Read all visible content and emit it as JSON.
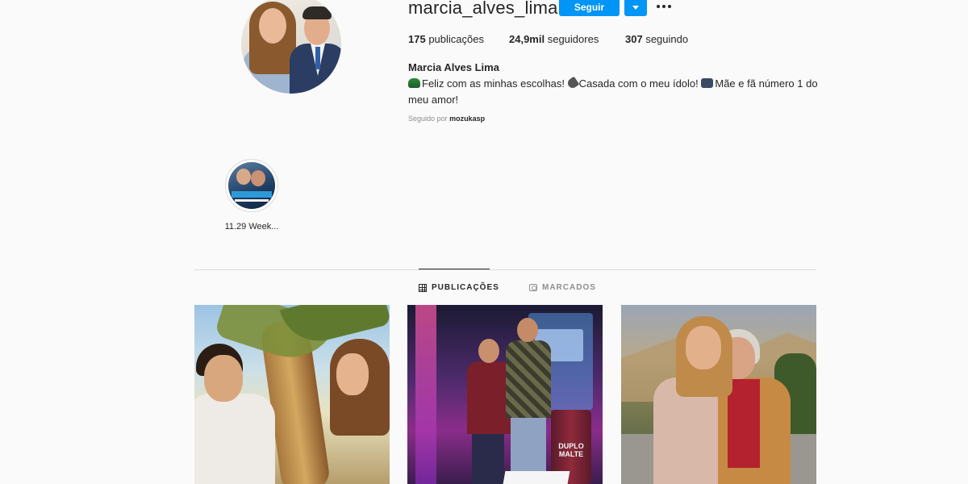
{
  "profile": {
    "username": "marcia_alves_lima",
    "follow_label": "Seguir",
    "stats": {
      "posts_count": "175",
      "posts_label": "publicações",
      "followers_count": "24,9mil",
      "followers_label": "seguidores",
      "following_count": "307",
      "following_label": "seguindo"
    },
    "full_name": "Marcia Alves Lima",
    "bio_parts": [
      "Feliz com as minhas escolhas! ",
      "Casada com o meu ídolo! ",
      "Mãe e fã número 1 do meu amor!"
    ],
    "followed_by_prefix": "Seguido por",
    "followed_by_user": "mozukasp"
  },
  "highlights": [
    {
      "label": "11.29 Week..."
    }
  ],
  "tabs": [
    {
      "label": "PUBLICAÇÕES",
      "icon": "grid-icon",
      "active": true
    },
    {
      "label": "MARCADOS",
      "icon": "tag-icon",
      "active": false
    }
  ],
  "posts": [
    {
      "overlay_text": ""
    },
    {
      "overlay_text": "DUPLO MALTE"
    },
    {
      "overlay_text": ""
    }
  ],
  "colors": {
    "accent": "#0095f6",
    "background": "#fafafa",
    "text": "#262626",
    "muted": "#8e8e8e"
  }
}
